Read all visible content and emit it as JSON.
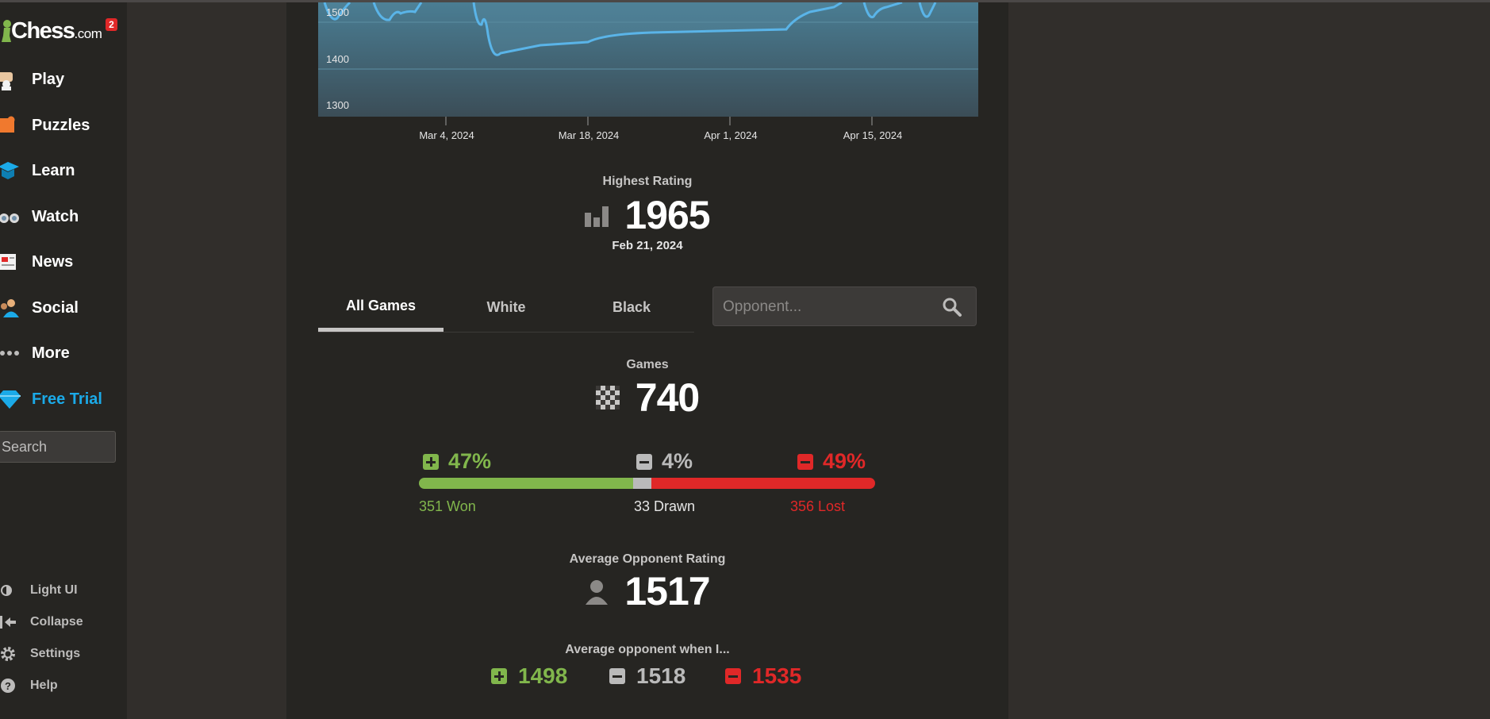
{
  "brand": {
    "name": "Chess",
    "suffix": ".com",
    "notification_count": "2"
  },
  "sidebar": {
    "items": [
      {
        "label": "Play",
        "icon": "play-icon"
      },
      {
        "label": "Puzzles",
        "icon": "puzzle-icon"
      },
      {
        "label": "Learn",
        "icon": "learn-icon"
      },
      {
        "label": "Watch",
        "icon": "binoculars-icon"
      },
      {
        "label": "News",
        "icon": "newspaper-icon"
      },
      {
        "label": "Social",
        "icon": "social-icon"
      },
      {
        "label": "More",
        "icon": "more-dots-icon"
      },
      {
        "label": "Free Trial",
        "icon": "diamond-icon"
      }
    ],
    "search_placeholder": "Search",
    "bottom": [
      {
        "label": "Light UI",
        "icon": "light-ui-icon"
      },
      {
        "label": "Collapse",
        "icon": "collapse-icon"
      },
      {
        "label": "Settings",
        "icon": "gear-icon"
      },
      {
        "label": "Help",
        "icon": "help-icon"
      }
    ]
  },
  "chart_data": {
    "type": "area",
    "y_ticks": [
      "1500",
      "1400",
      "1300"
    ],
    "x_ticks": [
      "Mar 4, 2024",
      "Mar 18, 2024",
      "Apr 1, 2024",
      "Apr 15, 2024"
    ],
    "line_color": "#5ab4e8",
    "fill_color": "#4a7d93"
  },
  "highest_rating": {
    "label": "Highest Rating",
    "value": "1965",
    "date": "Feb 21, 2024"
  },
  "tabs": [
    {
      "label": "All Games"
    },
    {
      "label": "White"
    },
    {
      "label": "Black"
    }
  ],
  "opponent_search": {
    "placeholder": "Opponent..."
  },
  "games": {
    "label": "Games",
    "value": "740",
    "won_pct": "47%",
    "drawn_pct": "4%",
    "lost_pct": "49%",
    "won_fraction": 0.47,
    "drawn_fraction": 0.04,
    "lost_fraction": 0.49,
    "won_label": "351 Won",
    "drawn_label": "33 Drawn",
    "lost_label": "356 Lost"
  },
  "avg_opponent": {
    "label": "Average Opponent Rating",
    "value": "1517"
  },
  "avg_when": {
    "label": "Average opponent when I...",
    "won": "1498",
    "drawn": "1518",
    "lost": "1535"
  },
  "colors": {
    "win": "#81b64c",
    "draw": "#bababa",
    "loss": "#e02828",
    "accent": "#1baae8"
  }
}
